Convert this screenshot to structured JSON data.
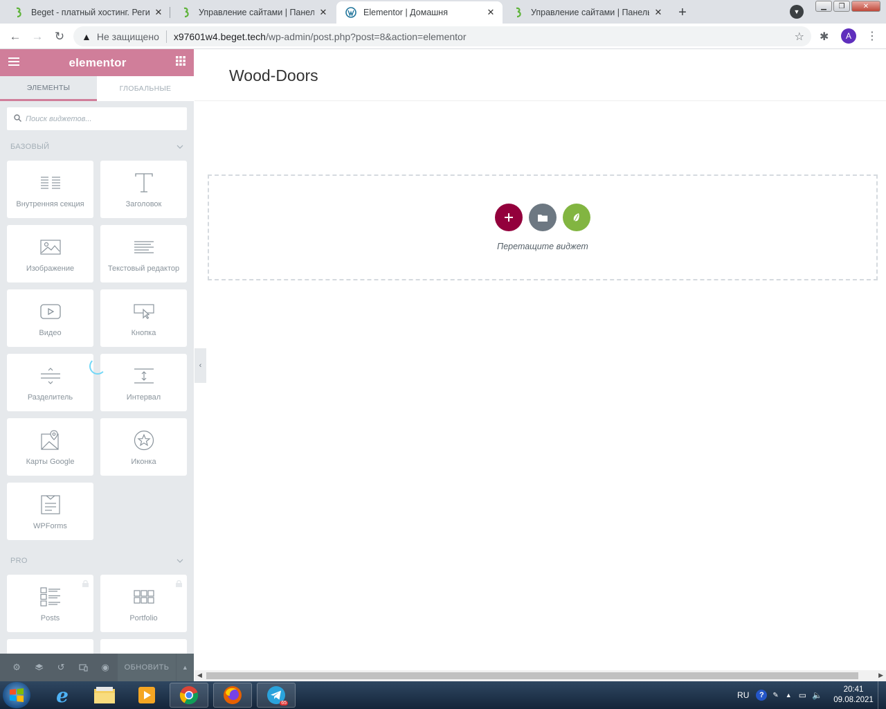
{
  "browser": {
    "tabs": [
      {
        "title": "Beget - платный хостинг. Регист",
        "favicon": "beget-icon"
      },
      {
        "title": "Управление сайтами | Панель у",
        "favicon": "beget-icon"
      },
      {
        "title": "Elementor | Домашня",
        "favicon": "wordpress-icon"
      },
      {
        "title": "Управление сайтами | Панель у",
        "favicon": "beget-icon"
      }
    ],
    "new_tab": "+",
    "security_label": "Не защищено",
    "url_host": "x97601w4.beget.tech",
    "url_path": "/wp-admin/post.php?post=8&action=elementor",
    "profile_initial": "A"
  },
  "panel": {
    "brand": "elementor",
    "tabs": [
      "ЭЛЕМЕНТЫ",
      "ГЛОБАЛЬНЫЕ"
    ],
    "search_placeholder": "Поиск виджетов...",
    "categories": {
      "basic": "БАЗОВЫЙ",
      "pro": "PRO"
    },
    "basic_widgets": [
      {
        "label": "Внутренняя секция",
        "icon": "inner-section-icon"
      },
      {
        "label": "Заголовок",
        "icon": "heading-icon"
      },
      {
        "label": "Изображение",
        "icon": "image-icon"
      },
      {
        "label": "Текстовый редактор",
        "icon": "text-editor-icon"
      },
      {
        "label": "Видео",
        "icon": "video-icon"
      },
      {
        "label": "Кнопка",
        "icon": "button-icon"
      },
      {
        "label": "Разделитель",
        "icon": "divider-icon"
      },
      {
        "label": "Интервал",
        "icon": "spacer-icon"
      },
      {
        "label": "Карты Google",
        "icon": "google-maps-icon"
      },
      {
        "label": "Иконка",
        "icon": "star-icon"
      },
      {
        "label": "WPForms",
        "icon": "wpforms-icon"
      }
    ],
    "pro_widgets": [
      {
        "label": "Posts",
        "icon": "posts-icon"
      },
      {
        "label": "Portfolio",
        "icon": "portfolio-icon"
      }
    ],
    "footer": {
      "update_label": "ОБНОВИТЬ"
    }
  },
  "canvas": {
    "page_title": "Wood-Doors",
    "drop_text": "Перетащите виджет"
  },
  "taskbar": {
    "lang": "RU",
    "time": "20:41",
    "date": "09.08.2021",
    "telegram_badge": "65"
  },
  "colors": {
    "elementor_pink": "#d07e9a",
    "add_button": "#93003c",
    "template_button": "#6d7882",
    "envato_button": "#82b541"
  }
}
